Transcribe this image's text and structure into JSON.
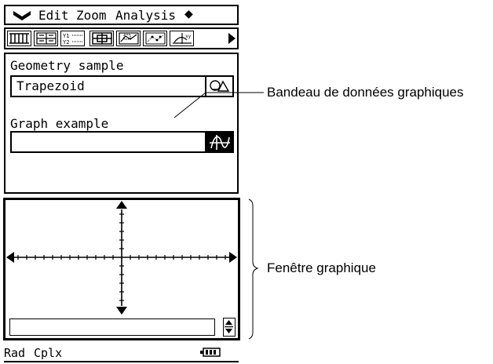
{
  "menubar": {
    "menu_glyph": "✔",
    "items": [
      "Edit",
      "Zoom",
      "Analysis"
    ],
    "more_glyph": "◆"
  },
  "toolbar": {
    "icons": [
      "matrix-editor-icon",
      "table-icon",
      "graph-editor-icon",
      "zoom-box-icon",
      "zoom-auto-icon",
      "scatter-icon",
      "conic-graph-icon"
    ],
    "next_arrow": "▶"
  },
  "panel": {
    "geometry_label": "Geometry sample",
    "geometry_strip": {
      "text": "Trapezoid",
      "icon": "geometry-app-icon"
    },
    "graph_label": "Graph example",
    "graph_strip": {
      "text": "",
      "icon": "graph-app-icon"
    }
  },
  "graph_window": {
    "input_value": "",
    "scroll_icon": "up-down-scroll-icon"
  },
  "statusbar": {
    "angle": "Rad",
    "mode": "Cplx",
    "battery_icon": "battery-icon"
  },
  "annotations": {
    "strip_callout": "Bandeau de données graphiques",
    "window_callout": "Fenêtre graphique"
  }
}
